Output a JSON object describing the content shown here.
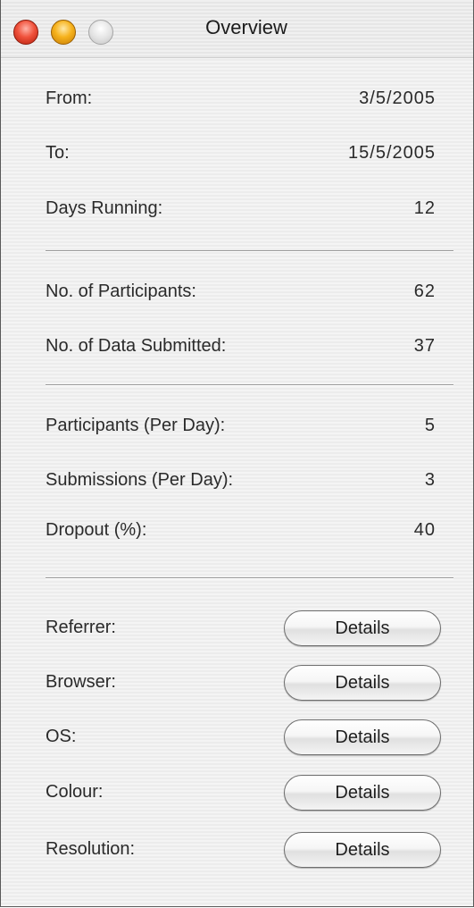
{
  "window": {
    "title": "Overview"
  },
  "dates": [
    {
      "label": "From:",
      "value": "3/5/2005"
    },
    {
      "label": "To:",
      "value": "15/5/2005"
    },
    {
      "label": "Days Running:",
      "value": "12"
    }
  ],
  "counts": [
    {
      "label": "No. of Participants:",
      "value": "62"
    },
    {
      "label": "No. of Data Submitted:",
      "value": "37"
    }
  ],
  "rates": [
    {
      "label": "Participants (Per Day):",
      "value": "5"
    },
    {
      "label": "Submissions (Per Day):",
      "value": "3"
    },
    {
      "label": "Dropout (%):",
      "value": "40"
    }
  ],
  "details": [
    {
      "label": "Referrer:",
      "button": "Details"
    },
    {
      "label": "Browser:",
      "button": "Details"
    },
    {
      "label": "OS:",
      "button": "Details"
    },
    {
      "label": "Colour:",
      "button": "Details"
    },
    {
      "label": "Resolution:",
      "button": "Details"
    }
  ]
}
